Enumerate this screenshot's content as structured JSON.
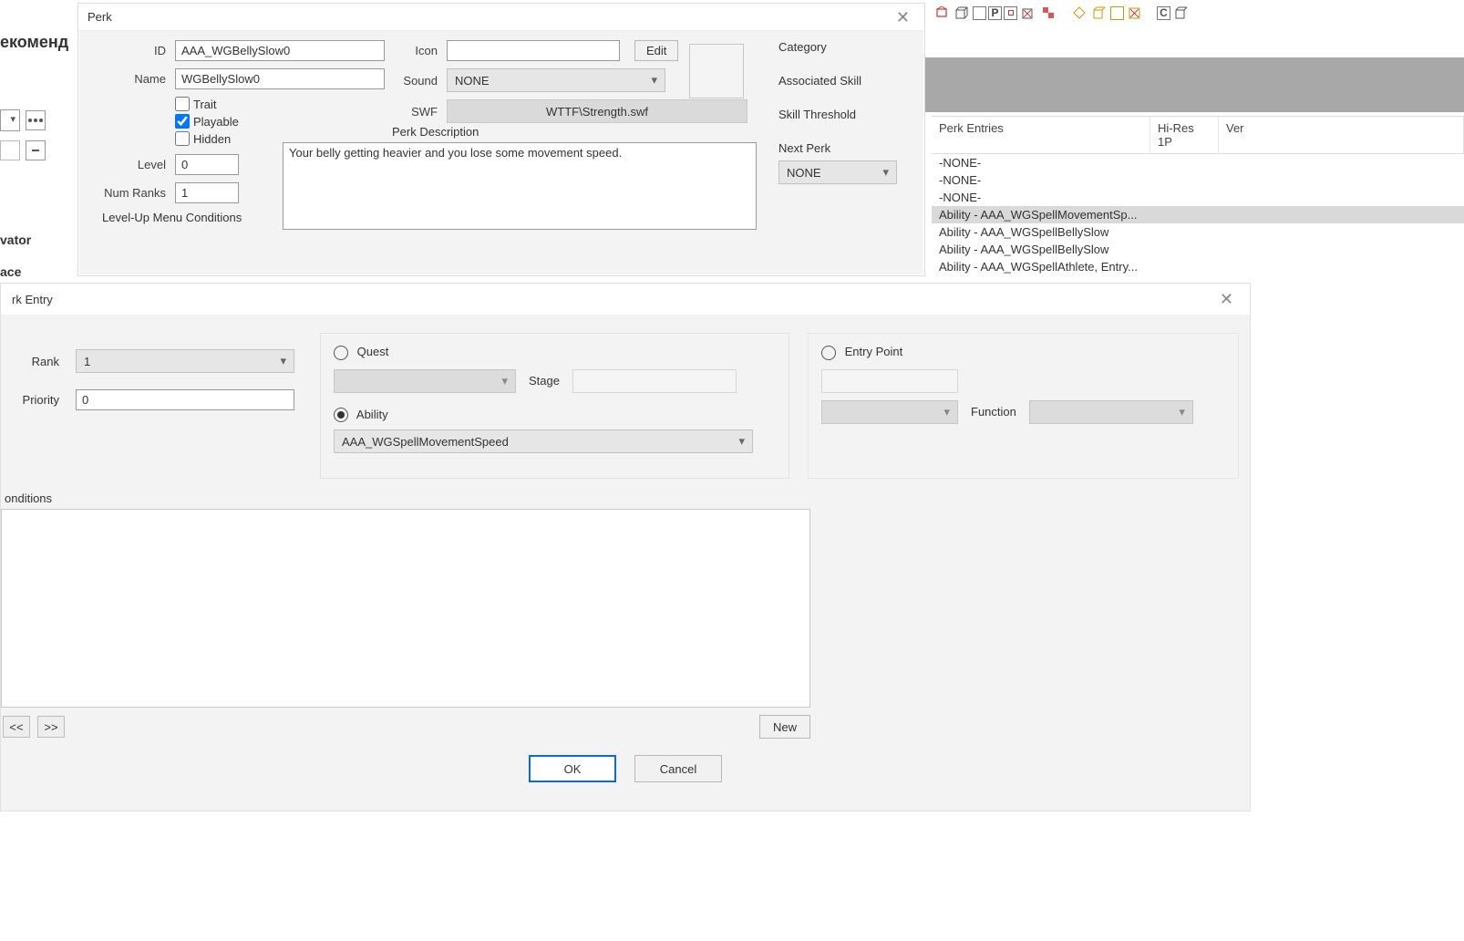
{
  "background": {
    "partial_tab": "екоменд",
    "side_labels": {
      "vator": "vator",
      "ace": "ace"
    }
  },
  "entries_table": {
    "headers": {
      "col1": "Perk Entries",
      "col2": "Hi-Res 1P",
      "col3": "Ver"
    },
    "rows": [
      {
        "text": "-NONE-",
        "selected": false
      },
      {
        "text": "-NONE-",
        "selected": false
      },
      {
        "text": "-NONE-",
        "selected": false
      },
      {
        "text": "Ability - AAA_WGSpellMovementSp...",
        "selected": true
      },
      {
        "text": "Ability - AAA_WGSpellBellySlow",
        "selected": false
      },
      {
        "text": "Ability - AAA_WGSpellBellySlow",
        "selected": false
      },
      {
        "text": "Ability - AAA_WGSpellAthlete, Entry...",
        "selected": false
      }
    ]
  },
  "perk_dialog": {
    "title": "Perk",
    "id_label": "ID",
    "id_value": "AAA_WGBellySlow0",
    "name_label": "Name",
    "name_value": "WGBellySlow0",
    "trait_label": "Trait",
    "playable_label": "Playable",
    "hidden_label": "Hidden",
    "trait_checked": false,
    "playable_checked": true,
    "hidden_checked": false,
    "level_label": "Level",
    "level_value": "0",
    "numranks_label": "Num Ranks",
    "numranks_value": "1",
    "icon_label": "Icon",
    "icon_value": "",
    "edit_button": "Edit",
    "sound_label": "Sound",
    "sound_value": "NONE",
    "swf_label": "SWF",
    "swf_value": "WTTF\\Strength.swf",
    "desc_label": "Perk Description",
    "desc_value": "Your belly getting heavier and you lose some movement speed.",
    "levelup_label": "Level-Up Menu Conditions",
    "side": {
      "category": "Category",
      "assoc_skill": "Associated Skill",
      "skill_threshold": "Skill Threshold",
      "next_perk": "Next Perk",
      "next_perk_value": "NONE"
    }
  },
  "entry_dialog": {
    "title": "rk Entry",
    "rank_label": "Rank",
    "rank_value": "1",
    "priority_label": "Priority",
    "priority_value": "0",
    "quest_label": "Quest",
    "stage_label": "Stage",
    "ability_label": "Ability",
    "ability_value": "AAA_WGSpellMovementSpeed",
    "entrypoint_label": "Entry Point",
    "function_label": "Function",
    "conditions_label": "onditions",
    "prev": "<<",
    "next": ">>",
    "new": "New",
    "ok": "OK",
    "cancel": "Cancel"
  }
}
